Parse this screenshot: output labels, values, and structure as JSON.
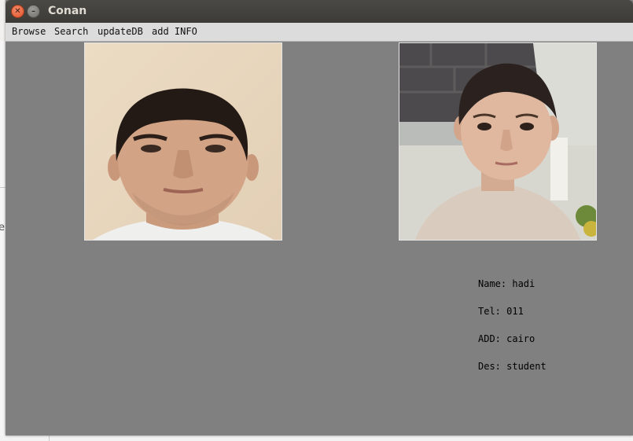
{
  "window": {
    "title": "Conan"
  },
  "menu": {
    "items": [
      {
        "label": "Browse"
      },
      {
        "label": "Search"
      },
      {
        "label": "updateDB"
      },
      {
        "label": "add INFO"
      }
    ]
  },
  "info": {
    "name": "Name: hadi",
    "tel": "Tel: 011",
    "add": "ADD: cairo",
    "des": "Des: student"
  },
  "background": {
    "glyph": "e"
  },
  "colors": {
    "window_bg": "#808080",
    "titlebar": "#3c3b37",
    "close_button": "#e3522a",
    "menubar": "#dcdcdc"
  }
}
